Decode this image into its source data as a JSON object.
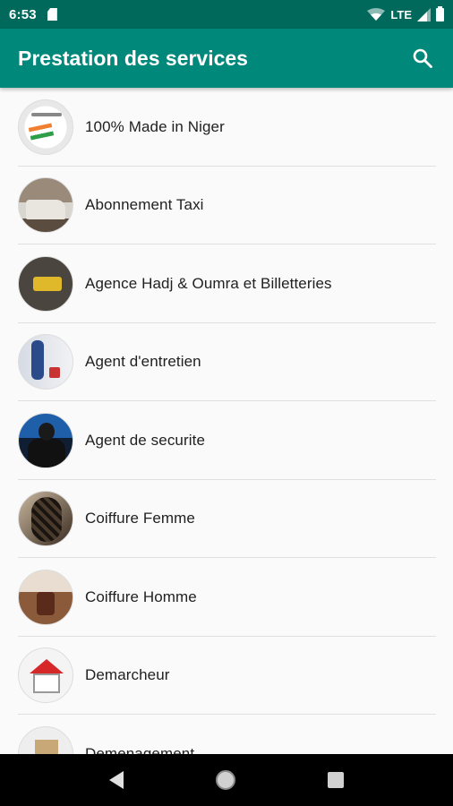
{
  "status_bar": {
    "time": "6:53",
    "network": "LTE",
    "icons": [
      "sd-card-icon",
      "wifi-icon",
      "signal-icon",
      "battery-icon"
    ]
  },
  "app_bar": {
    "title": "Prestation des services",
    "search_icon": "search-icon"
  },
  "list": {
    "items": [
      {
        "label": "100% Made in Niger"
      },
      {
        "label": "Abonnement Taxi"
      },
      {
        "label": "Agence Hadj & Oumra et Billetteries"
      },
      {
        "label": "Agent d'entretien"
      },
      {
        "label": "Agent de securite"
      },
      {
        "label": "Coiffure Femme"
      },
      {
        "label": "Coiffure Homme"
      },
      {
        "label": "Demarcheur"
      },
      {
        "label": "Demenagement"
      }
    ]
  },
  "nav_bar": {
    "icons": [
      "back-icon",
      "home-icon",
      "recents-icon"
    ]
  },
  "colors": {
    "status_bar": "#00695c",
    "app_bar": "#00897b",
    "background": "#fafafa",
    "divider": "#e0e0e0"
  }
}
